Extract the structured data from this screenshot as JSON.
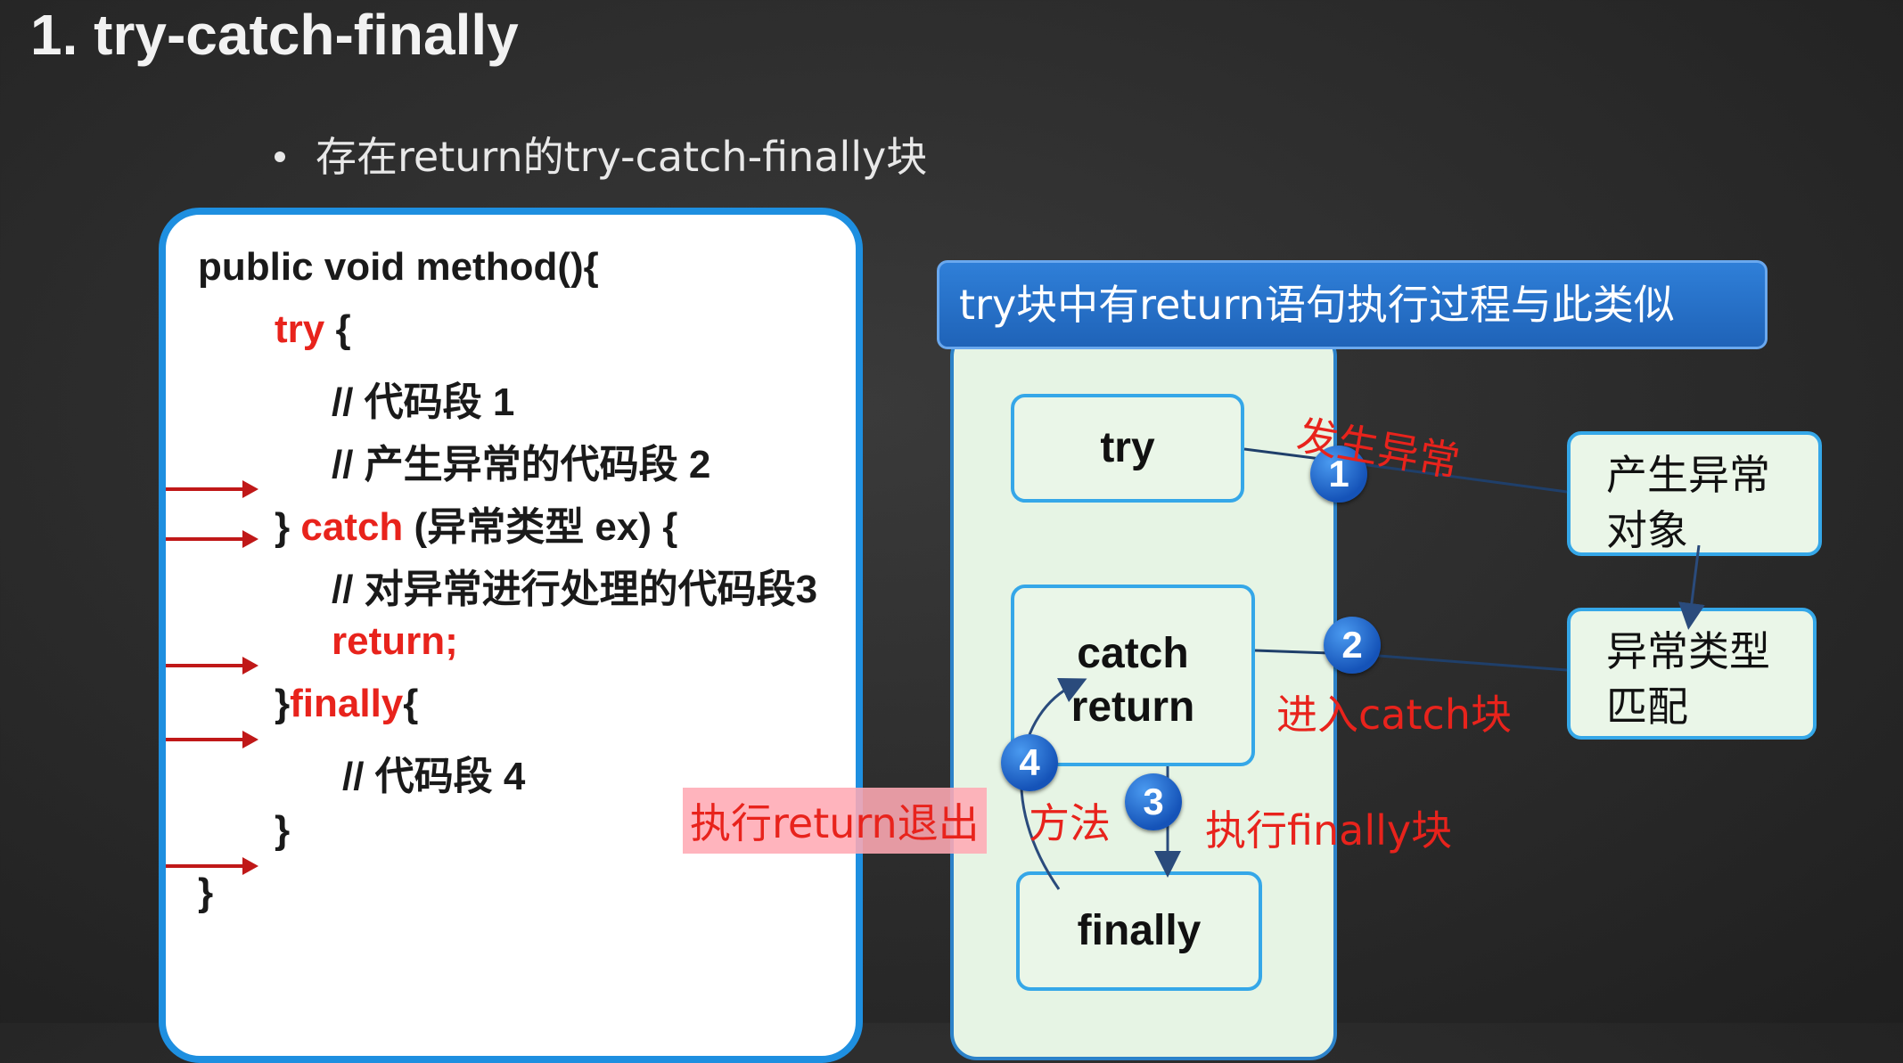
{
  "slide": {
    "title": "1. try-catch-finally",
    "bullet": "存在return的try-catch-finally块"
  },
  "code": {
    "lines": [
      {
        "pre": "public void method(){",
        "kw": "",
        "post": ""
      },
      {
        "pre": "",
        "kw": "try",
        "post": " {"
      },
      {
        "pre": "// 代码段 1",
        "kw": "",
        "post": ""
      },
      {
        "pre": "// 产生异常的代码段 2",
        "kw": "",
        "post": ""
      },
      {
        "pre": "} ",
        "kw": "catch",
        "post": " (异常类型 ex) {"
      },
      {
        "pre": "// 对异常进行处理的代码段3",
        "kw": "",
        "post": ""
      },
      {
        "pre": "",
        "kw": "return;",
        "post": ""
      },
      {
        "pre": "}",
        "kw": "finally",
        "post": "{"
      },
      {
        "pre": "// 代码段 4",
        "kw": "",
        "post": ""
      },
      {
        "pre": "}",
        "kw": "",
        "post": ""
      },
      {
        "pre": "}",
        "kw": "",
        "post": ""
      }
    ]
  },
  "diagram": {
    "header": "try块中有return语句执行过程与此类似",
    "box_try": "try",
    "box_catch_1": "catch",
    "box_catch_2": "return",
    "box_finally": "finally",
    "box_exception_1": "产生异常",
    "box_exception_2": "对象",
    "box_match_1": "异常类型",
    "box_match_2": "匹配",
    "badges": [
      "1",
      "2",
      "3",
      "4"
    ],
    "label_exception": "发生异常",
    "label_enter_catch": "进入catch块",
    "label_exec_finally": "执行finally块",
    "label_return_exit": "执行return退出",
    "label_method": "方法"
  },
  "colors": {
    "keyword": "#e8231c",
    "accent_blue": "#1e8fe0",
    "badge_blue": "#1553b8",
    "arrow_red": "#c01818"
  }
}
